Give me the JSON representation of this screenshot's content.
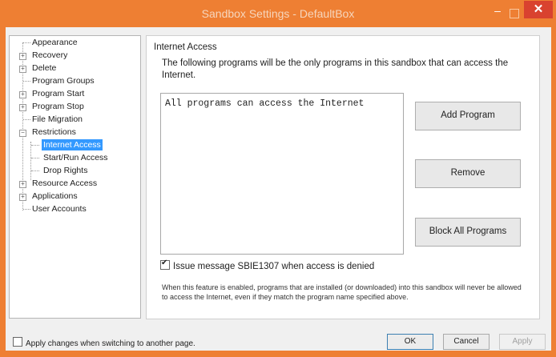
{
  "window": {
    "title": "Sandbox Settings - DefaultBox",
    "minimize_glyph": "–",
    "close_glyph": "✕"
  },
  "tree": {
    "items": [
      {
        "label": "Appearance",
        "has_children": false,
        "expanded": false
      },
      {
        "label": "Recovery",
        "has_children": true,
        "expanded": false
      },
      {
        "label": "Delete",
        "has_children": true,
        "expanded": false
      },
      {
        "label": "Program Groups",
        "has_children": false,
        "expanded": false
      },
      {
        "label": "Program Start",
        "has_children": true,
        "expanded": false
      },
      {
        "label": "Program Stop",
        "has_children": true,
        "expanded": false
      },
      {
        "label": "File Migration",
        "has_children": false,
        "expanded": false
      },
      {
        "label": "Restrictions",
        "has_children": true,
        "expanded": true
      },
      {
        "label": "Internet Access",
        "has_children": false,
        "selected": true
      },
      {
        "label": "Start/Run Access",
        "has_children": false
      },
      {
        "label": "Drop Rights",
        "has_children": false
      },
      {
        "label": "Resource Access",
        "has_children": true,
        "expanded": false
      },
      {
        "label": "Applications",
        "has_children": true,
        "expanded": false
      },
      {
        "label": "User Accounts",
        "has_children": false,
        "expanded": false
      }
    ],
    "expand_glyph": "+",
    "collapse_glyph": "−"
  },
  "panel": {
    "title": "Internet Access",
    "description": "The following programs will be the only programs in this sandbox that can access the Internet.",
    "list_items": [
      "All programs can access the Internet"
    ],
    "add_program": "Add Program",
    "remove": "Remove",
    "block_all": "Block All Programs",
    "issue_message_checked": true,
    "issue_message_label": "Issue message SBIE1307 when access is denied",
    "note": "When this feature is enabled, programs that are installed (or downloaded) into this sandbox will never be allowed to access the Internet, even if they match the program name specified above."
  },
  "footer": {
    "apply_on_switch_checked": false,
    "apply_on_switch_label": "Apply changes when switching to another page.",
    "ok": "OK",
    "cancel": "Cancel",
    "apply": "Apply"
  },
  "colors": {
    "titlebar": "#ee7f33",
    "close_button": "#d9422f",
    "selection": "#3399ff"
  }
}
